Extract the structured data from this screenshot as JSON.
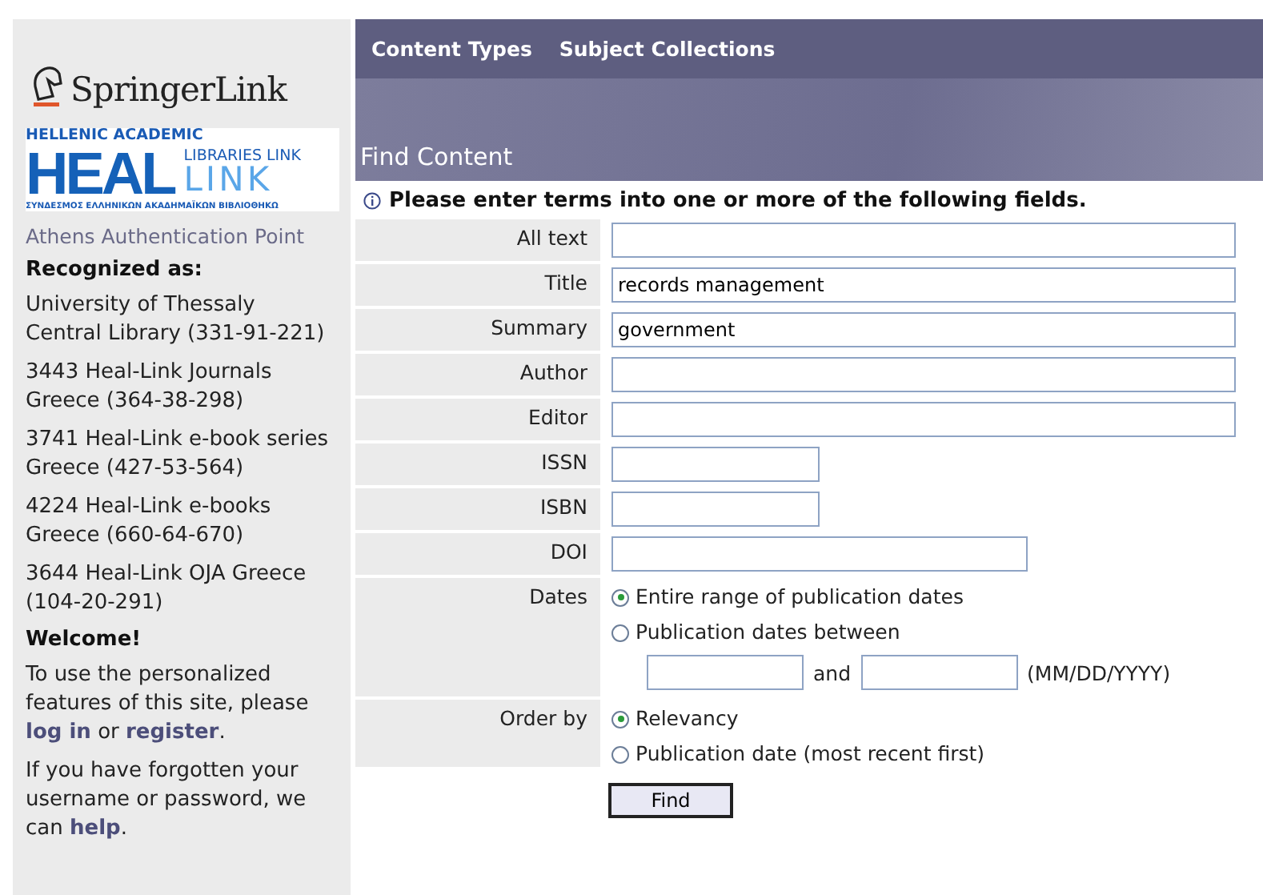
{
  "sidebar": {
    "brand": "SpringerLink",
    "partner_logo": {
      "top": "HELLENIC ACADEMIC",
      "big": "HEAL",
      "right_top": "LIBRARIES LINK",
      "right_big": "LINK",
      "bottom": "ΣΥΝΔΕΣΜΟΣ ΕΛΛΗΝΙΚΩΝ ΑΚΑΔΗΜΑΪΚΩΝ ΒΙΒΛΙΟΘΗΚΩ"
    },
    "auth_point": "Athens Authentication Point",
    "recognized_heading": "Recognized as:",
    "institutions": [
      "University of Thessaly Central Library (331-91-221)",
      "3443 Heal-Link Journals Greece (364-38-298)",
      "3741 Heal-Link e-book series Greece (427-53-564)",
      "4224 Heal-Link e-books Greece (660-64-670)",
      "3644 Heal-Link OJA Greece (104-20-291)"
    ],
    "welcome_heading": "Welcome!",
    "paragraphs": [
      [
        {
          "kind": "text",
          "text": "To use the personalized features of this site, please "
        },
        {
          "kind": "link",
          "text": "log in"
        },
        {
          "kind": "text",
          "text": " or "
        },
        {
          "kind": "link",
          "text": "register"
        },
        {
          "kind": "text",
          "text": "."
        }
      ],
      [
        {
          "kind": "text",
          "text": "If you have forgotten your username or password, we can "
        },
        {
          "kind": "link",
          "text": "help"
        },
        {
          "kind": "text",
          "text": "."
        }
      ]
    ]
  },
  "nav": [
    "Content Types",
    "Subject Collections"
  ],
  "banner_title": "Find Content",
  "instruction": "Please enter terms into one or more of the following fields.",
  "fields": [
    {
      "label": "All text",
      "kind": "long"
    },
    {
      "label": "Title",
      "kind": "long",
      "value": "records management"
    },
    {
      "label": "Summary",
      "kind": "long",
      "value": "government"
    },
    {
      "label": "Author",
      "kind": "long"
    },
    {
      "label": "Editor",
      "kind": "long"
    },
    {
      "label": "ISSN",
      "kind": "short"
    },
    {
      "label": "ISBN",
      "kind": "short"
    },
    {
      "label": "DOI",
      "kind": "medium"
    }
  ],
  "dates": {
    "label": "Dates",
    "options": [
      {
        "label": "Entire range of publication dates",
        "selected": true
      },
      {
        "label": "Publication dates between",
        "selected": false
      }
    ],
    "joiner": "and",
    "format": "(MM/DD/YYYY)"
  },
  "order": {
    "label": "Order by",
    "options": [
      {
        "label": "Relevancy",
        "selected": true
      },
      {
        "label": "Publication date (most recent first)",
        "selected": false
      }
    ]
  },
  "submit": "Find"
}
